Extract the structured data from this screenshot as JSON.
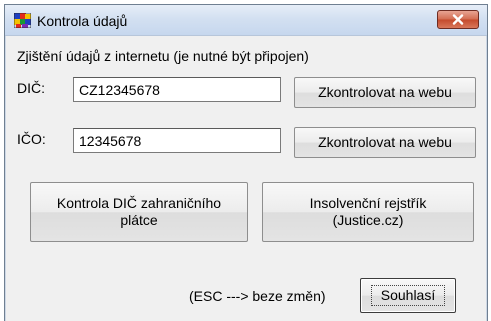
{
  "window": {
    "title": "Kontrola údajů",
    "app_icon": "colorful-puzzle-icon",
    "close_icon": "close-icon"
  },
  "section": {
    "heading": "Zjištění údajů z internetu (je nutné být připojen)"
  },
  "dic": {
    "label": "DIČ:",
    "value": "CZ12345678",
    "button": "Zkontrolovat na webu"
  },
  "ico": {
    "label": "IČO:",
    "value": "12345678",
    "button": "Zkontrolovat na webu"
  },
  "foreign_vat_button": {
    "line1": "Kontrola DIČ zahraničního",
    "line2": "plátce"
  },
  "insolvency_button": {
    "line1": "Insolvenční rejstřík",
    "line2": "(Justice.cz)"
  },
  "footer": {
    "esc_hint": "(ESC ---> beze změn)",
    "confirm_button": "Souhlasí"
  },
  "colors": {
    "close_button": "#c44a2c",
    "dialog_background": "#f0f0f0",
    "titlebar": "#d3e0f1"
  }
}
